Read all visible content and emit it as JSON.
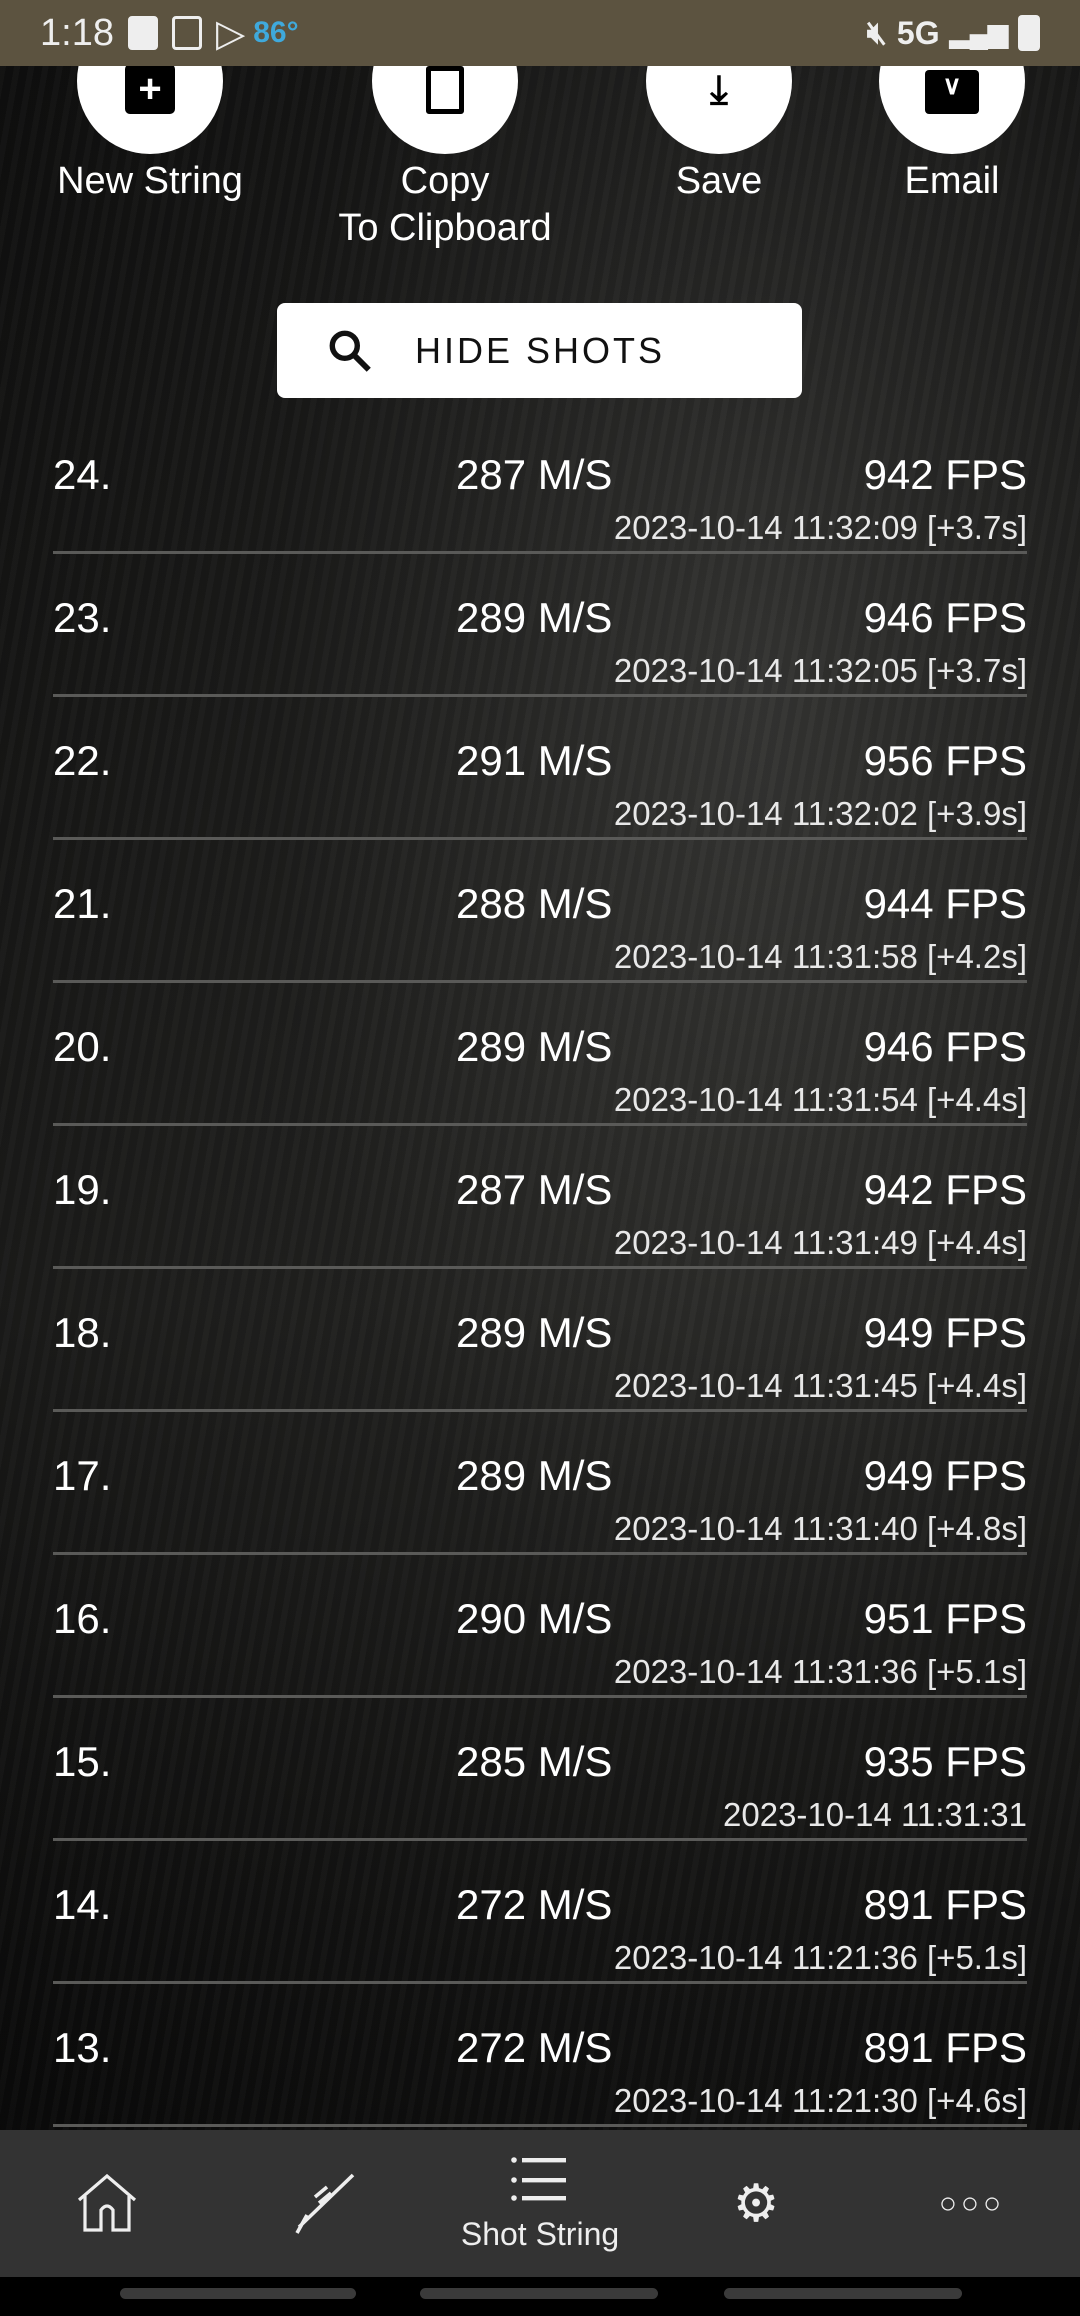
{
  "status_bar": {
    "time": "1:18",
    "temperature": "86°",
    "network": "5G"
  },
  "actions": [
    {
      "label": "New String",
      "icon": "add-box-icon"
    },
    {
      "label": "Copy\nTo Clipboard",
      "label_line1": "Copy",
      "label_line2": "To Clipboard",
      "icon": "copy-icon"
    },
    {
      "label": "Save",
      "icon": "download-icon"
    },
    {
      "label": "Email",
      "icon": "mail-icon"
    }
  ],
  "hide_shots": {
    "label": "HIDE SHOTS",
    "icon": "search-icon"
  },
  "shots": [
    {
      "num": "24.",
      "ms": "287 M/S",
      "fps": "942 FPS",
      "ts": "2023-10-14 11:32:09 [+3.7s]"
    },
    {
      "num": "23.",
      "ms": "289 M/S",
      "fps": "946 FPS",
      "ts": "2023-10-14 11:32:05 [+3.7s]"
    },
    {
      "num": "22.",
      "ms": "291 M/S",
      "fps": "956 FPS",
      "ts": "2023-10-14 11:32:02 [+3.9s]"
    },
    {
      "num": "21.",
      "ms": "288 M/S",
      "fps": "944 FPS",
      "ts": "2023-10-14 11:31:58 [+4.2s]"
    },
    {
      "num": "20.",
      "ms": "289 M/S",
      "fps": "946 FPS",
      "ts": "2023-10-14 11:31:54 [+4.4s]"
    },
    {
      "num": "19.",
      "ms": "287 M/S",
      "fps": "942 FPS",
      "ts": "2023-10-14 11:31:49 [+4.4s]"
    },
    {
      "num": "18.",
      "ms": "289 M/S",
      "fps": "949 FPS",
      "ts": "2023-10-14 11:31:45 [+4.4s]"
    },
    {
      "num": "17.",
      "ms": "289 M/S",
      "fps": "949 FPS",
      "ts": "2023-10-14 11:31:40 [+4.8s]"
    },
    {
      "num": "16.",
      "ms": "290 M/S",
      "fps": "951 FPS",
      "ts": "2023-10-14 11:31:36 [+5.1s]"
    },
    {
      "num": "15.",
      "ms": "285 M/S",
      "fps": "935 FPS",
      "ts": "2023-10-14 11:31:31"
    },
    {
      "num": "14.",
      "ms": "272 M/S",
      "fps": "891 FPS",
      "ts": "2023-10-14 11:21:36 [+5.1s]"
    },
    {
      "num": "13.",
      "ms": "272 M/S",
      "fps": "891 FPS",
      "ts": "2023-10-14 11:21:30 [+4.6s]"
    }
  ],
  "nav": {
    "active": "Shot String",
    "items": [
      {
        "icon": "home-icon"
      },
      {
        "icon": "rifle-icon"
      },
      {
        "icon": "list-icon",
        "label": "Shot String"
      },
      {
        "icon": "gears-icon"
      },
      {
        "icon": "more-icon"
      }
    ]
  }
}
